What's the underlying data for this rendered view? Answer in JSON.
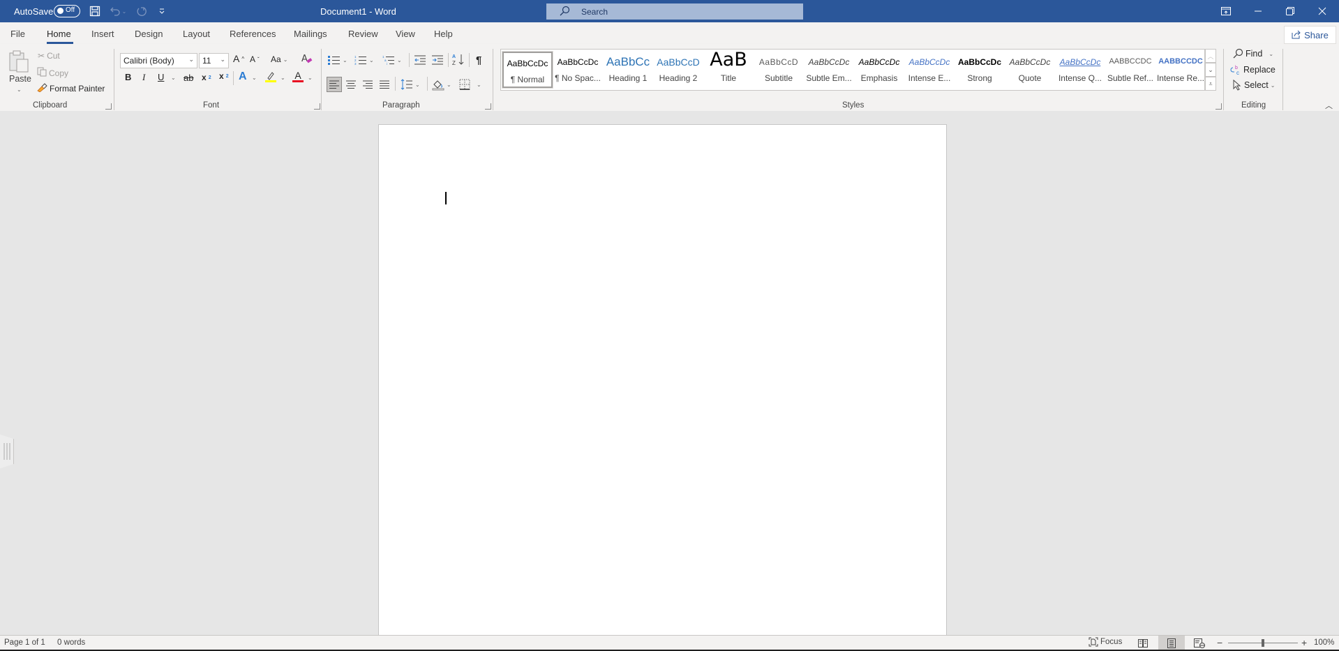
{
  "titlebar": {
    "autosave_label": "AutoSave",
    "autosave_state": "Off",
    "document_title": "Document1  -  Word",
    "search_placeholder": "Search",
    "icons": [
      "save-icon",
      "undo-icon",
      "undo-dropdown-icon",
      "redo-icon",
      "customize-qat-icon",
      "ribbon-display-options-icon",
      "minimize-icon",
      "restore-icon",
      "close-icon"
    ]
  },
  "tabs": [
    {
      "label": "File"
    },
    {
      "label": "Home",
      "active": true
    },
    {
      "label": "Insert"
    },
    {
      "label": "Design"
    },
    {
      "label": "Layout"
    },
    {
      "label": "References"
    },
    {
      "label": "Mailings"
    },
    {
      "label": "Review"
    },
    {
      "label": "View"
    },
    {
      "label": "Help"
    }
  ],
  "share_label": "Share",
  "ribbon": {
    "clipboard": {
      "label": "Clipboard",
      "paste": "Paste",
      "cut": "Cut",
      "copy": "Copy",
      "format_painter": "Format Painter"
    },
    "font": {
      "label": "Font",
      "font_name": "Calibri (Body)",
      "font_size": "11",
      "grow": "A",
      "shrink": "A",
      "change_case": "Aa",
      "bold": "B",
      "italic": "I",
      "underline": "U",
      "strikethrough": "ab",
      "subscript": "x",
      "superscript": "x",
      "text_effects": "A",
      "font_color": "A",
      "highlight_color": "#ffff00",
      "font_color_value": "#e81123"
    },
    "paragraph": {
      "label": "Paragraph",
      "show_hide": "¶",
      "active_alignment": "left"
    },
    "styles": {
      "label": "Styles",
      "items": [
        {
          "sample": "AaBbCcDc",
          "label": "¶ Normal",
          "selected": true
        },
        {
          "sample": "AaBbCcDc",
          "label": "¶ No Spac..."
        },
        {
          "sample": "AaBbCc",
          "label": "Heading 1"
        },
        {
          "sample": "AaBbCcD",
          "label": "Heading 2"
        },
        {
          "sample": "AaB",
          "label": "Title"
        },
        {
          "sample": "AaBbCcD",
          "label": "Subtitle"
        },
        {
          "sample": "AaBbCcDc",
          "label": "Subtle Em..."
        },
        {
          "sample": "AaBbCcDc",
          "label": "Emphasis"
        },
        {
          "sample": "AaBbCcDc",
          "label": "Intense E..."
        },
        {
          "sample": "AaBbCcDc",
          "label": "Strong"
        },
        {
          "sample": "AaBbCcDc",
          "label": "Quote"
        },
        {
          "sample": "AaBbCcDc",
          "label": "Intense Q..."
        },
        {
          "sample": "AaBbCcDc",
          "label": "Subtle Ref..."
        },
        {
          "sample": "AaBbCcDc",
          "label": "Intense Re..."
        }
      ]
    },
    "editing": {
      "label": "Editing",
      "find": "Find",
      "replace": "Replace",
      "select": "Select"
    }
  },
  "statusbar": {
    "page": "Page 1 of 1",
    "words": "0 words",
    "focus": "Focus",
    "zoom_minus": "−",
    "zoom_plus": "+",
    "zoom_level": "100%",
    "zoom_percent": 100,
    "active_view": "print-layout"
  }
}
